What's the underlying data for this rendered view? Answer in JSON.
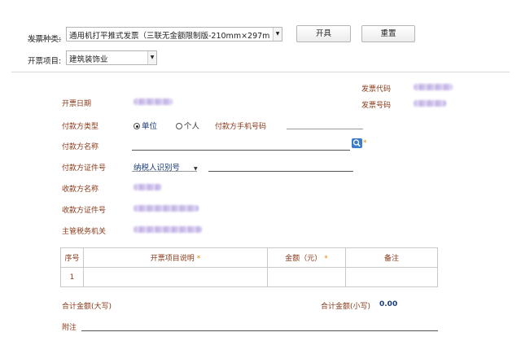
{
  "top": {
    "invoice_type_label": "发票种类:",
    "invoice_type_value": "通用机打平推式发票（三联无金额限制版-210mm×297m",
    "invoice_item_label": "开票项目:",
    "invoice_item_value": "建筑装饰业",
    "issue_button": "开具",
    "reset_button": "重置"
  },
  "form": {
    "invoice_code_label": "发票代码",
    "invoice_number_label": "发票号码",
    "issue_date_label": "开票日期",
    "payer_type_label": "付款方类型",
    "payer_type_options": [
      "单位",
      "个人"
    ],
    "payer_phone_label": "付款方手机号码",
    "payer_name_label": "付款方名称",
    "payer_id_label": "付款方证件号",
    "payer_id_type_value": "纳税人识别号",
    "payee_name_label": "收款方名称",
    "payee_id_label": "收款方证件号",
    "tax_authority_label": "主管税务机关",
    "required_mark": "*"
  },
  "table": {
    "headers": [
      "序号",
      "开票项目说明",
      "金额（元）",
      "备注"
    ],
    "rows": [
      {
        "index": "1",
        "desc": "",
        "amount": "",
        "note": ""
      }
    ]
  },
  "totals": {
    "total_upper_label": "合计金额(大写)",
    "total_lower_label": "合计金额(小写)",
    "total_lower_value": "0.00",
    "remark_label": "附注"
  },
  "colors": {
    "label": "#8b3a1a",
    "required": "#e08a00",
    "search_button": "#3b7dc9"
  },
  "icons": {
    "search": "search-icon",
    "dropdown": "chevron-down-icon"
  }
}
